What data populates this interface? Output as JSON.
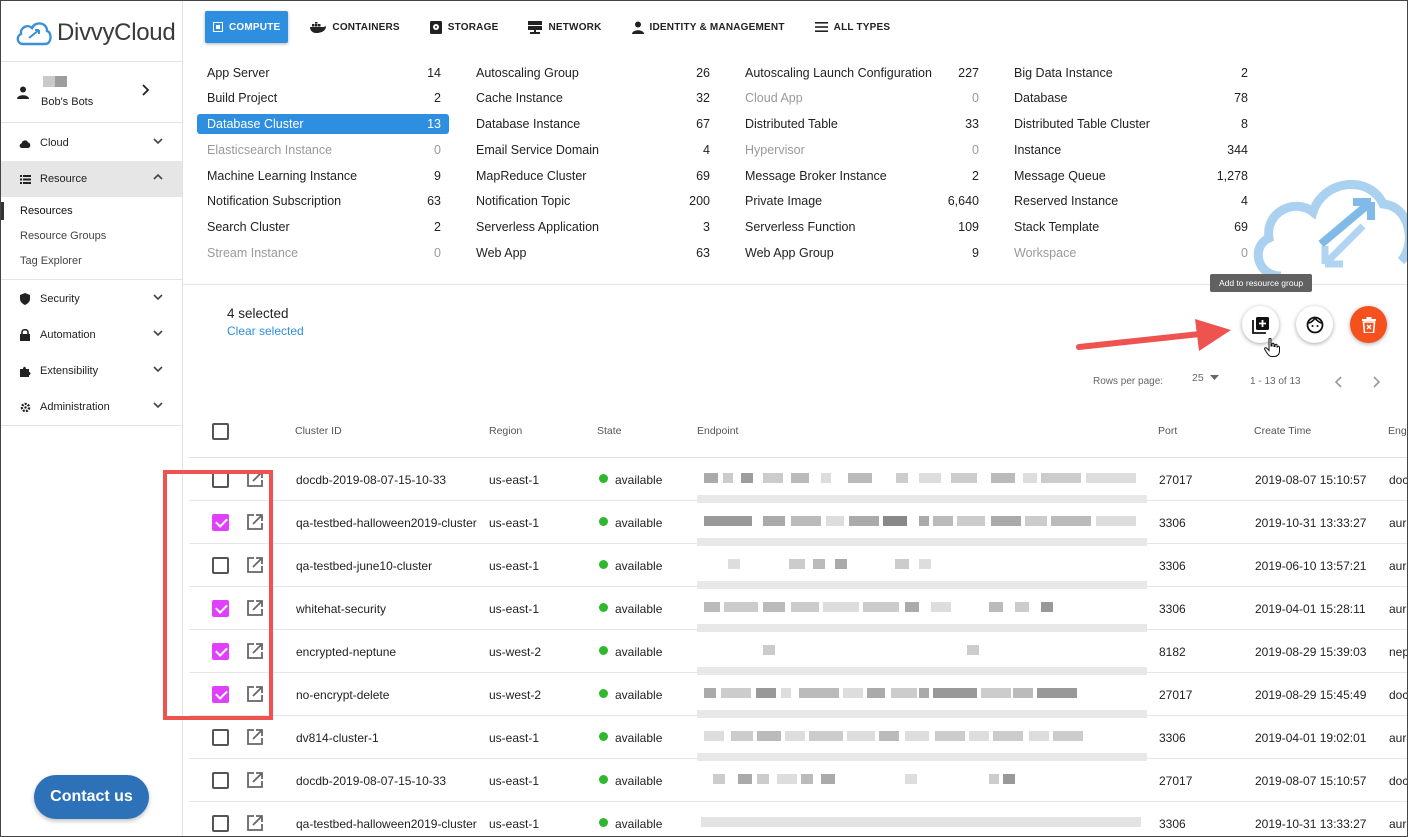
{
  "app": {
    "name": "DivvyCloud"
  },
  "account": {
    "name": "Bob's Bots"
  },
  "sidebar": {
    "items": [
      {
        "label": "Cloud",
        "icon": "cloud-icon"
      },
      {
        "label": "Resource",
        "icon": "list-icon"
      },
      {
        "label": "Security",
        "icon": "shield-icon"
      },
      {
        "label": "Automation",
        "icon": "lock-icon"
      },
      {
        "label": "Extensibility",
        "icon": "puzzle-icon"
      },
      {
        "label": "Administration",
        "icon": "gear-icon"
      }
    ],
    "resource_sub": [
      "Resources",
      "Resource Groups",
      "Tag Explorer"
    ],
    "contact_label": "Contact us"
  },
  "tabs": [
    {
      "label": "COMPUTE",
      "icon": "compute-icon",
      "active": true
    },
    {
      "label": "CONTAINERS",
      "icon": "docker-icon"
    },
    {
      "label": "STORAGE",
      "icon": "storage-icon"
    },
    {
      "label": "NETWORK",
      "icon": "network-icon"
    },
    {
      "label": "IDENTITY & MANAGEMENT",
      "icon": "person-icon"
    },
    {
      "label": "ALL TYPES",
      "icon": "menu-icon"
    }
  ],
  "resource_types": {
    "col1": [
      {
        "name": "App Server",
        "count": "14"
      },
      {
        "name": "Build Project",
        "count": "2"
      },
      {
        "name": "Database Cluster",
        "count": "13",
        "selected": true
      },
      {
        "name": "Elasticsearch Instance",
        "count": "0",
        "dim": true
      },
      {
        "name": "Machine Learning Instance",
        "count": "9"
      },
      {
        "name": "Notification Subscription",
        "count": "63"
      },
      {
        "name": "Search Cluster",
        "count": "2"
      },
      {
        "name": "Stream Instance",
        "count": "0",
        "dim": true
      }
    ],
    "col2": [
      {
        "name": "Autoscaling Group",
        "count": "26"
      },
      {
        "name": "Cache Instance",
        "count": "32"
      },
      {
        "name": "Database Instance",
        "count": "67"
      },
      {
        "name": "Email Service Domain",
        "count": "4"
      },
      {
        "name": "MapReduce Cluster",
        "count": "69"
      },
      {
        "name": "Notification Topic",
        "count": "200"
      },
      {
        "name": "Serverless Application",
        "count": "3"
      },
      {
        "name": "Web App",
        "count": "63"
      }
    ],
    "col3": [
      {
        "name": "Autoscaling Launch Configuration",
        "count": "227"
      },
      {
        "name": "Cloud App",
        "count": "0",
        "dim": true
      },
      {
        "name": "Distributed Table",
        "count": "33"
      },
      {
        "name": "Hypervisor",
        "count": "0",
        "dim": true
      },
      {
        "name": "Message Broker Instance",
        "count": "2"
      },
      {
        "name": "Private Image",
        "count": "6,640"
      },
      {
        "name": "Serverless Function",
        "count": "109"
      },
      {
        "name": "Web App Group",
        "count": "9"
      }
    ],
    "col4": [
      {
        "name": "Big Data Instance",
        "count": "2"
      },
      {
        "name": "Database",
        "count": "78"
      },
      {
        "name": "Distributed Table Cluster",
        "count": "8"
      },
      {
        "name": "Instance",
        "count": "344"
      },
      {
        "name": "Message Queue",
        "count": "1,278"
      },
      {
        "name": "Reserved Instance",
        "count": "4"
      },
      {
        "name": "Stack Template",
        "count": "69"
      },
      {
        "name": "Workspace",
        "count": "0",
        "dim": true
      }
    ]
  },
  "selection": {
    "count_text": "4 selected",
    "clear_label": "Clear selected"
  },
  "tooltip": "Add to resource group",
  "pagination": {
    "rows_label": "Rows per page:",
    "rows_value": "25",
    "range": "1 - 13 of 13"
  },
  "table": {
    "headers": [
      "Cluster ID",
      "Region",
      "State",
      "Endpoint",
      "Port",
      "Create Time",
      "Engi"
    ],
    "rows": [
      {
        "id": "docdb-2019-08-07-15-10-33",
        "region": "us-east-1",
        "state": "available",
        "port": "27017",
        "time": "2019-08-07 15:10:57",
        "engine": "doc",
        "checked": false
      },
      {
        "id": "qa-testbed-halloween2019-cluster",
        "region": "us-east-1",
        "state": "available",
        "port": "3306",
        "time": "2019-10-31 13:33:27",
        "engine": "aur",
        "checked": true
      },
      {
        "id": "qa-testbed-june10-cluster",
        "region": "us-east-1",
        "state": "available",
        "port": "3306",
        "time": "2019-06-10 13:57:21",
        "engine": "aur",
        "checked": false
      },
      {
        "id": "whitehat-security",
        "region": "us-east-1",
        "state": "available",
        "port": "3306",
        "time": "2019-04-01 15:28:11",
        "engine": "aur",
        "checked": true
      },
      {
        "id": "encrypted-neptune",
        "region": "us-west-2",
        "state": "available",
        "port": "8182",
        "time": "2019-08-29 15:39:03",
        "engine": "nep",
        "checked": true
      },
      {
        "id": "no-encrypt-delete",
        "region": "us-west-2",
        "state": "available",
        "port": "27017",
        "time": "2019-08-29 15:45:49",
        "engine": "doc",
        "checked": true
      },
      {
        "id": "dv814-cluster-1",
        "region": "us-east-1",
        "state": "available",
        "port": "3306",
        "time": "2019-04-01 19:02:01",
        "engine": "aur",
        "checked": false
      },
      {
        "id": "docdb-2019-08-07-15-10-33",
        "region": "us-east-1",
        "state": "available",
        "port": "27017",
        "time": "2019-08-07 15:10:57",
        "engine": "doc",
        "checked": false
      },
      {
        "id": "qa-testbed-halloween2019-cluster",
        "region": "us-east-1",
        "state": "available",
        "port": "3306",
        "time": "2019-10-31 13:33:27",
        "engine": "aur",
        "checked": false
      }
    ]
  },
  "colors": {
    "accent": "#2e8ee0",
    "checkbox": "#e040fb",
    "delete": "#f4511e",
    "annotation": "#ef5350",
    "available": "#2eb82e"
  }
}
